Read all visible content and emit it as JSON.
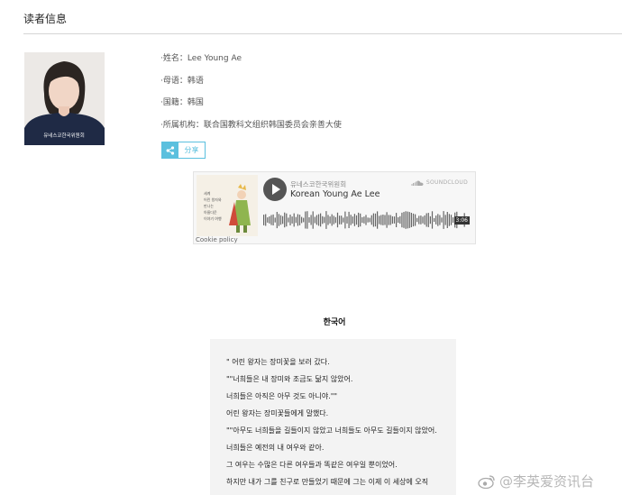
{
  "section": {
    "title": "读者信息"
  },
  "profile": {
    "name_label": "·姓名：",
    "name_value": "Lee Young Ae",
    "language_label": "·母语：",
    "language_value": "韩语",
    "nationality_label": "·国籍：",
    "nationality_value": "韩国",
    "org_label": "·所属机构：",
    "org_value": "联合国教科文组织韩国委员会亲善大使",
    "avatar_shirt_text": "유네스코한국위원회"
  },
  "share": {
    "label": "分享",
    "icon": "share-icon"
  },
  "player": {
    "uploader": "유네스코한국위원회",
    "track_title": "Korean Young Ae Lee",
    "brand": "SOUNDCLOUD",
    "duration": "3:06",
    "cookie_policy": "Cookie policy",
    "cover_lines": [
      "세계",
      "어린 왕자와",
      "만나는",
      "아름다운",
      "이야기 여행"
    ],
    "accent_color": "#ff5500"
  },
  "lyrics": {
    "language_title": "한국어",
    "lines": [
      "\"  어린 왕자는 장미꽃을 보러 갔다.",
      "\"\"너희들은 내 장미와 조금도 닮지 않았어.",
      "너희들은 아직은 아무 것도 아니야.\"\"",
      "어린 왕자는 장미꽃들에게 말했다.",
      "\"\"아무도 너희들을 길들이지 않았고 너희들도 아무도 길들이지 않았어.",
      "너희들은 예전의 내 여우와 같아.",
      "그 여우는 수많은 다른 여우들과 똑같은 여우일 뿐이었어.",
      "하지만 내가 그를 친구로 만들었기 때문에 그는 이제 이 세상에 오직"
    ]
  },
  "watermark": {
    "text": "@李英爱资讯台"
  }
}
